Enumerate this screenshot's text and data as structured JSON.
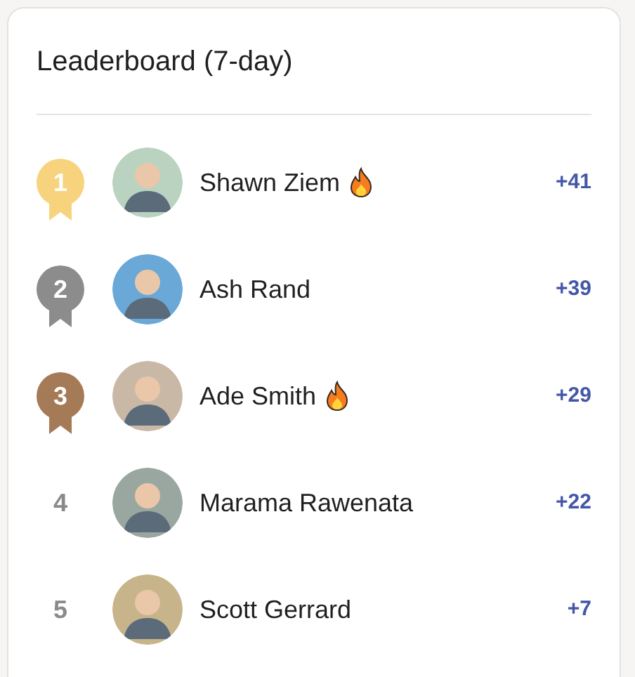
{
  "title": "Leaderboard (7-day)",
  "entries": [
    {
      "rank": "1",
      "kind": "medal",
      "color": "#f7d37e",
      "name": "Shawn Ziem",
      "on_fire": true,
      "points": "+41"
    },
    {
      "rank": "2",
      "kind": "medal",
      "color": "#8c8c8c",
      "name": "Ash Rand",
      "on_fire": false,
      "points": "+39"
    },
    {
      "rank": "3",
      "kind": "medal",
      "color": "#a57a56",
      "name": "Ade Smith",
      "on_fire": true,
      "points": "+29"
    },
    {
      "rank": "4",
      "kind": "plain",
      "name": "Marama Rawenata",
      "on_fire": false,
      "points": "+22"
    },
    {
      "rank": "5",
      "kind": "plain",
      "name": "Scott Gerrard",
      "on_fire": false,
      "points": "+7"
    }
  ]
}
